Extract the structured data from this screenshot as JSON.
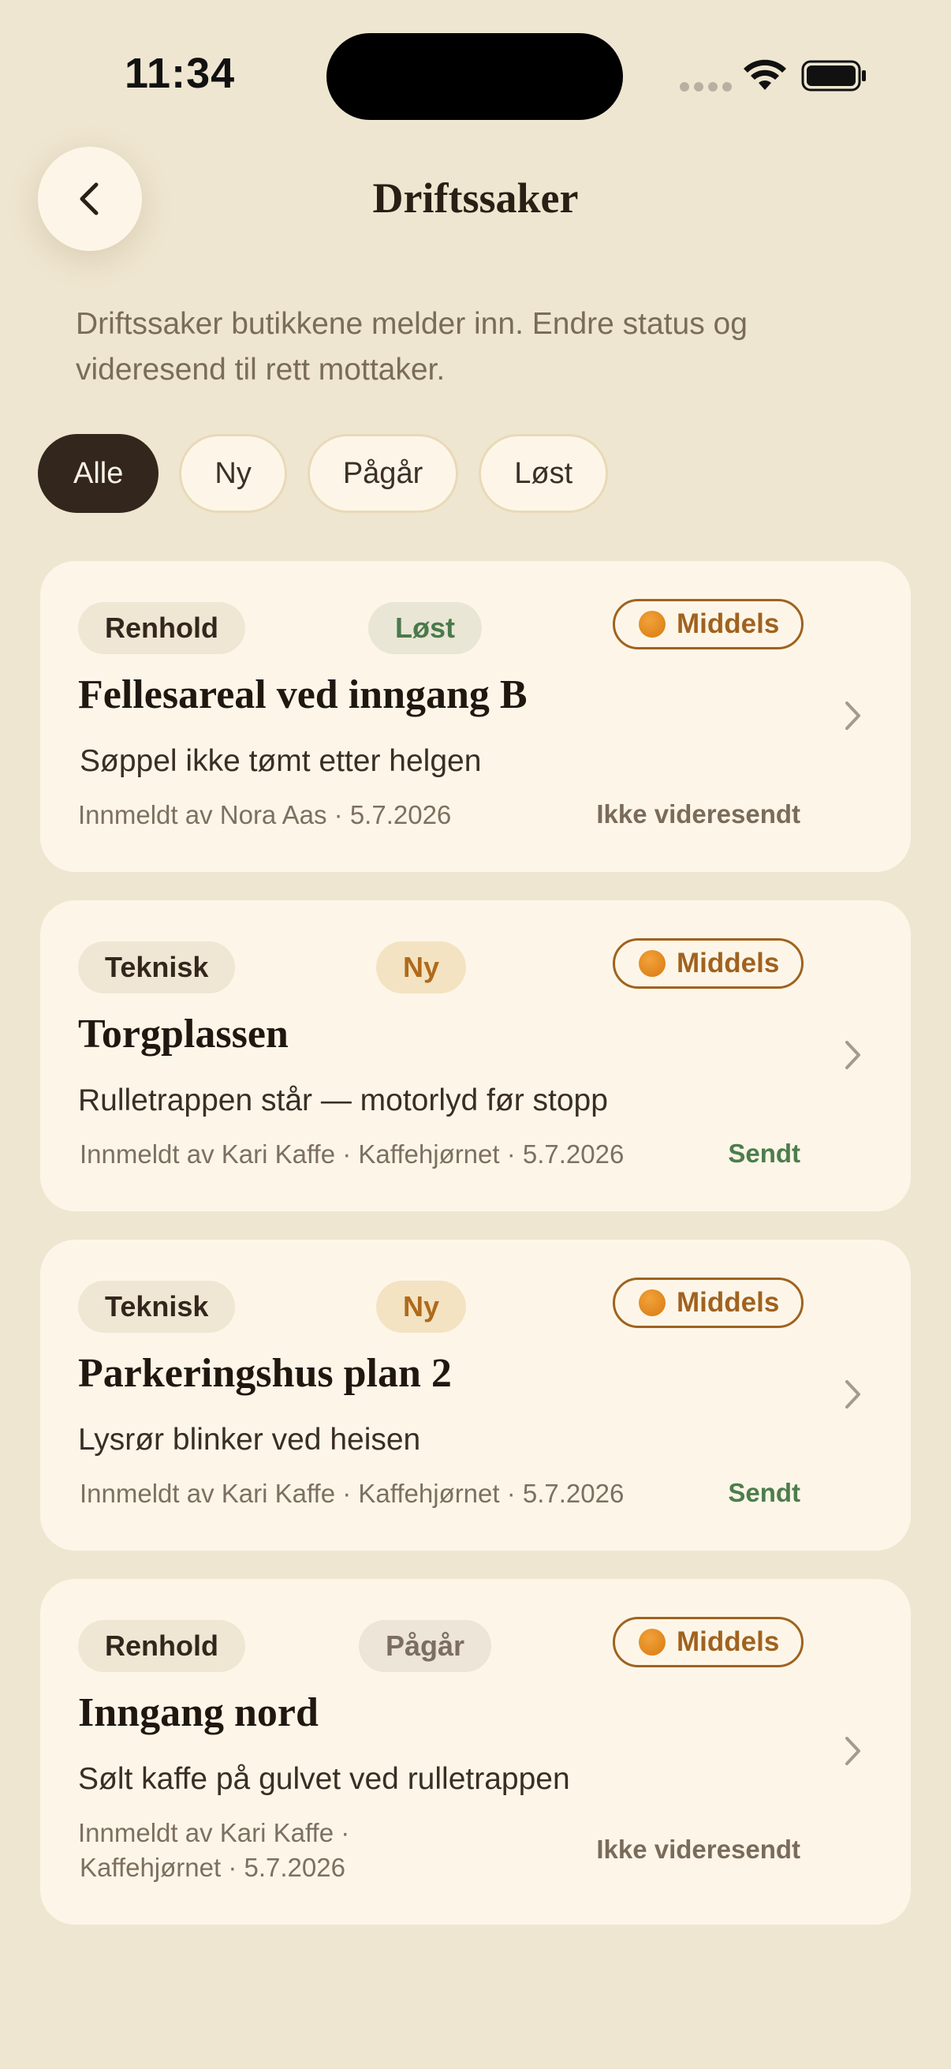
{
  "status_bar": {
    "time": "11:34"
  },
  "header": {
    "title": "Driftssaker"
  },
  "description": "Driftssaker butikkene melder inn. Endre status og videresend til rett mottaker.",
  "filters": [
    {
      "label": "Alle",
      "active": true
    },
    {
      "label": "Ny",
      "active": false
    },
    {
      "label": "Pågår",
      "active": false
    },
    {
      "label": "Løst",
      "active": false
    }
  ],
  "cases": [
    {
      "category": "Renhold",
      "status": "Løst",
      "priority": "Middels",
      "title": "Fellesareal ved inngang B",
      "subtitle": "Søppel ikke tømt etter helgen",
      "meta": "Innmeldt av Nora Aas · 5.7.2026",
      "forward_status": "Ikke videresendt"
    },
    {
      "category": "Teknisk",
      "status": "Ny",
      "priority": "Middels",
      "title": "Torgplassen",
      "subtitle": "Rulletrappen står — motorlyd før stopp",
      "meta": "Innmeldt av Kari Kaffe · Kaffehjørnet · 5.7.2026",
      "forward_status": "Sendt"
    },
    {
      "category": "Teknisk",
      "status": "Ny",
      "priority": "Middels",
      "title": "Parkeringshus plan 2",
      "subtitle": "Lysrør blinker ved heisen",
      "meta": "Innmeldt av Kari Kaffe · Kaffehjørnet · 5.7.2026",
      "forward_status": "Sendt"
    },
    {
      "category": "Renhold",
      "status": "Pågår",
      "priority": "Middels",
      "title": "Inngang nord",
      "subtitle": "Sølt kaffe på gulvet ved rulletrappen",
      "meta_line1": "Innmeldt av Kari Kaffe ·",
      "meta_line2": "Kaffehjørnet · 5.7.2026",
      "forward_status": "Ikke videresendt"
    }
  ],
  "colors": {
    "background": "#efe6d1",
    "card": "#fdf6e8",
    "accent_dark": "#33271d",
    "priority": "#a0621f",
    "sent": "#4d7d4c"
  }
}
